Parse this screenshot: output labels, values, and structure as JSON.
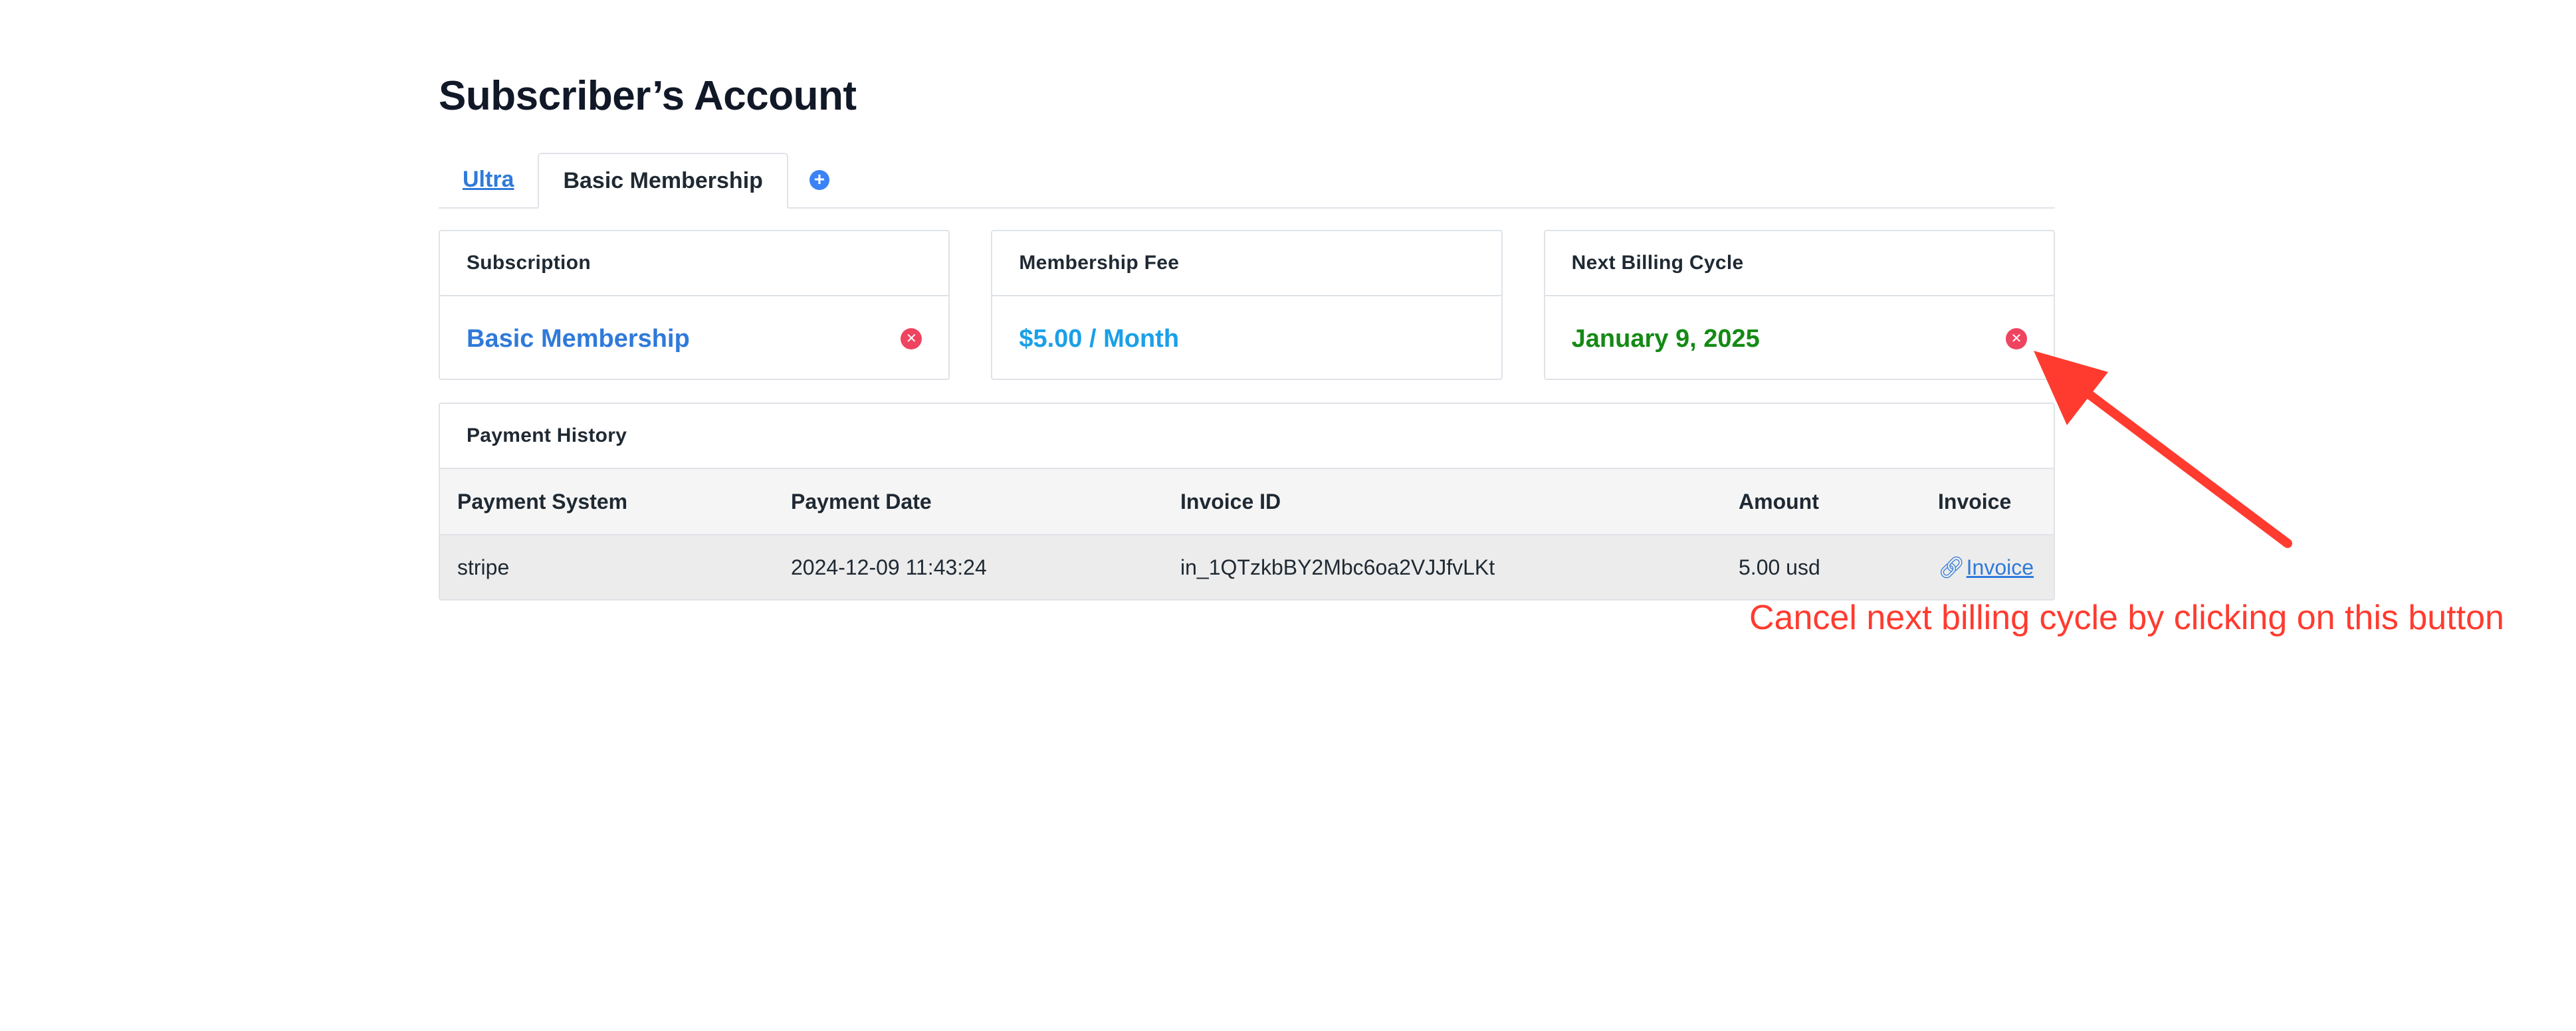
{
  "page": {
    "title": "Subscriber’s Account"
  },
  "tabs": [
    {
      "label": "Ultra"
    },
    {
      "label": "Basic Membership"
    }
  ],
  "cards": {
    "subscription": {
      "heading": "Subscription",
      "value": "Basic Membership",
      "value_color": "#2f7ad9"
    },
    "fee": {
      "heading": "Membership Fee",
      "value": "$5.00 / Month",
      "value_color": "#1aa0e8"
    },
    "billing": {
      "heading": "Next Billing Cycle",
      "value": "January 9, 2025",
      "value_color": "#148a14"
    }
  },
  "history": {
    "heading": "Payment History",
    "columns": [
      "Payment System",
      "Payment Date",
      "Invoice ID",
      "Amount",
      "Invoice"
    ],
    "rows": [
      {
        "system": "stripe",
        "date": "2024-12-09 11:43:24",
        "invoice_id": "in_1QTzkbBY2Mbc6oa2VJJfvLKt",
        "amount": "5.00 usd",
        "invoice": "Invoice"
      }
    ]
  },
  "annotation": {
    "text": "Cancel next billing cycle by clicking on this button",
    "color": "#ff3b2f"
  }
}
